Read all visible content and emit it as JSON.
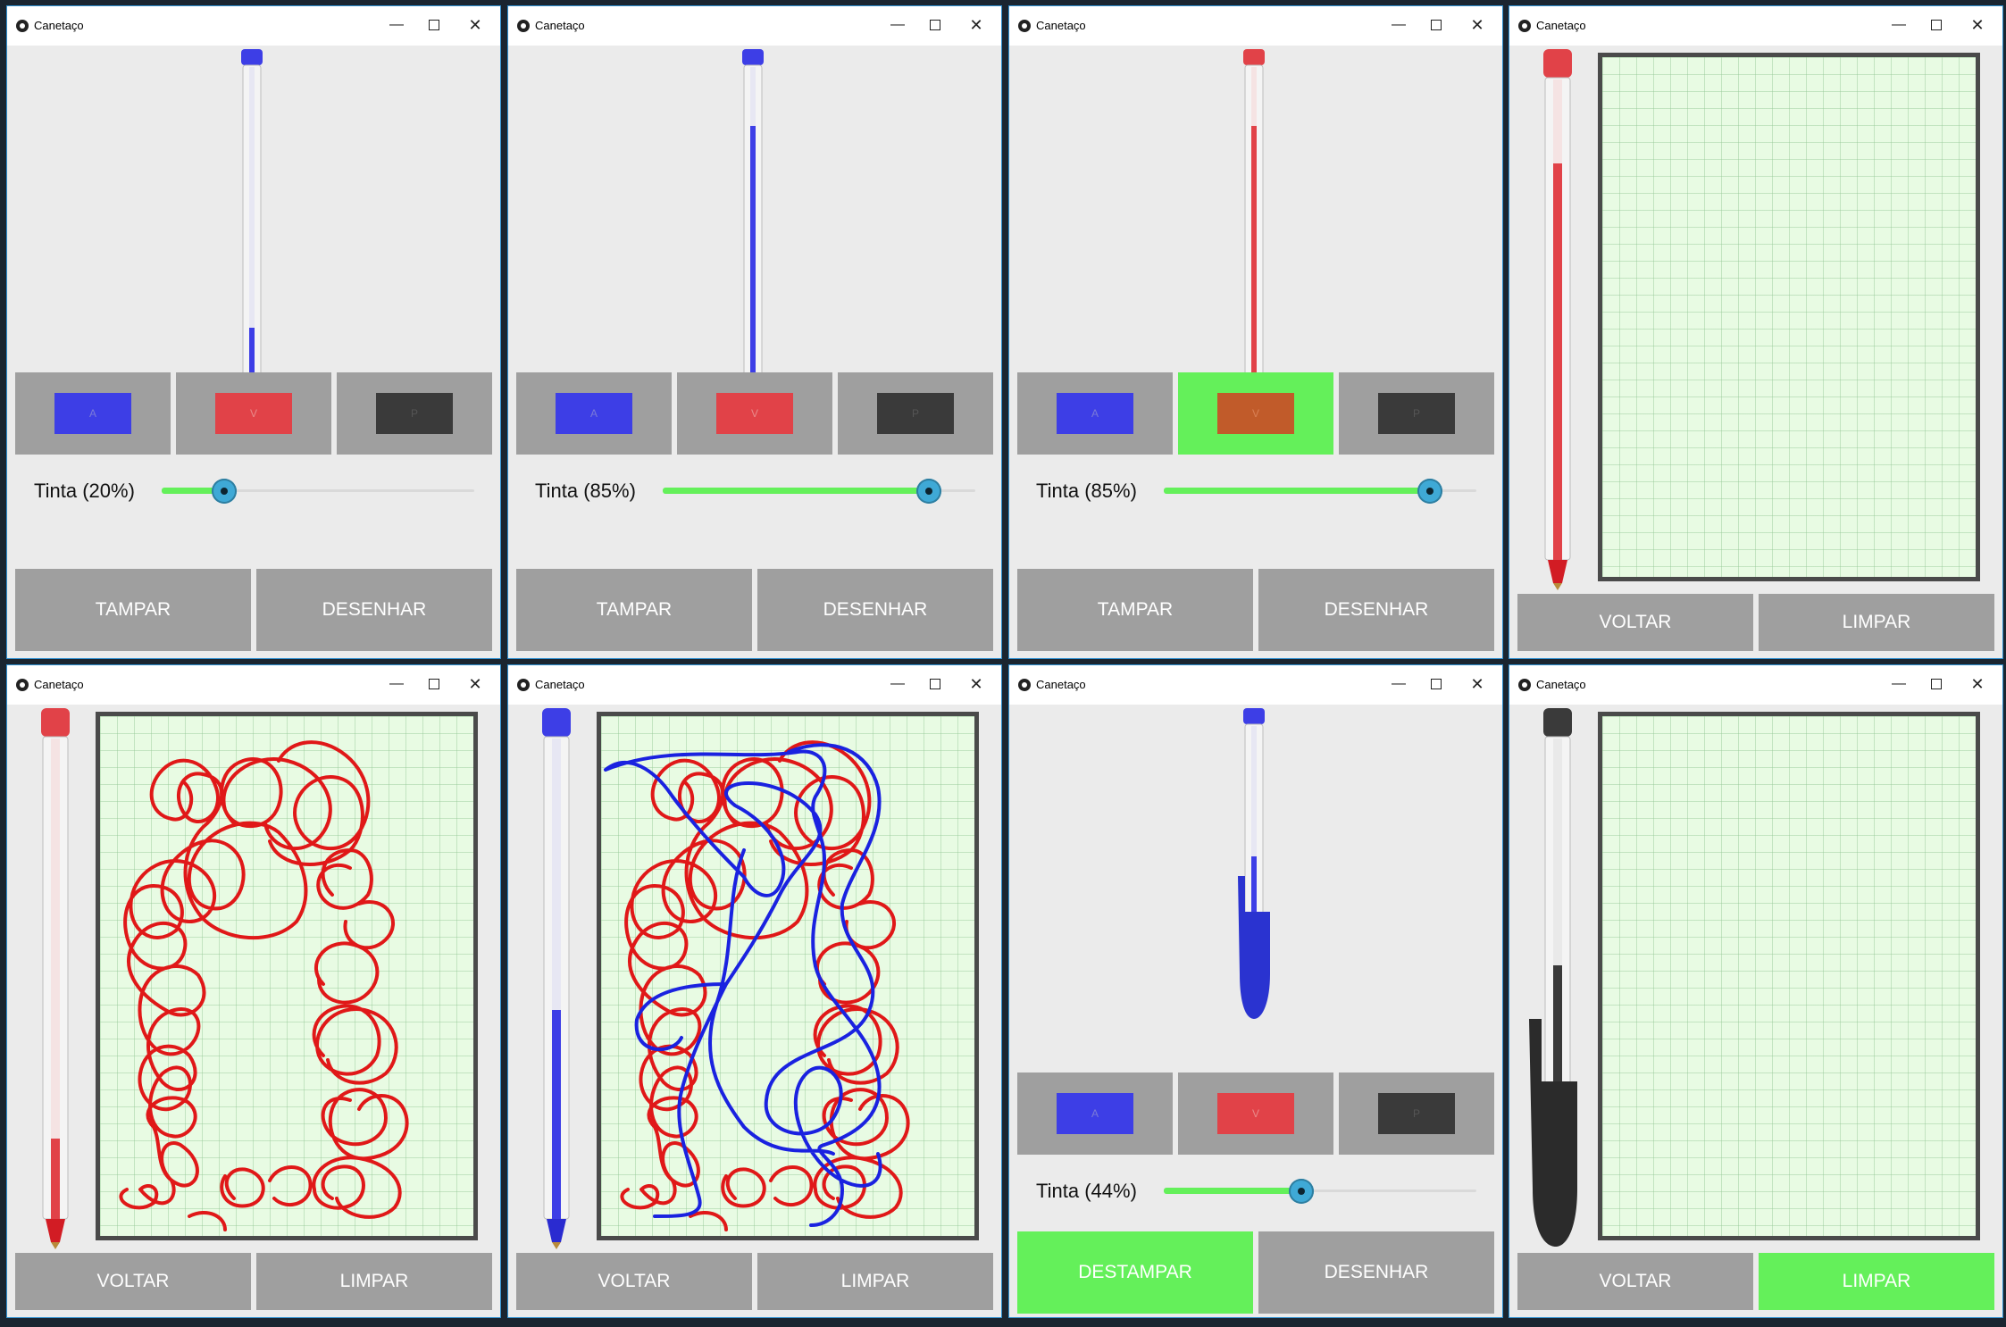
{
  "app": {
    "title": "Canetaço"
  },
  "colors": {
    "blue": "#3d3ee6",
    "red": "#e14248",
    "black": "#3a3a3a",
    "selected_green": "#64f05a",
    "button_gray": "#9f9f9f"
  },
  "panels": [
    {
      "window_title": "Canetaço",
      "mode": "main",
      "pen_color": "blue",
      "capped": false,
      "ink_fraction": 0.2,
      "swatches": [
        "A",
        "V",
        "P"
      ],
      "selected_swatch": null,
      "tinta_label": "Tinta (20%)",
      "action_left": "TAMPAR",
      "action_right": "DESENHAR"
    },
    {
      "window_title": "Canetaço",
      "mode": "main",
      "pen_color": "blue",
      "capped": false,
      "ink_fraction": 0.85,
      "swatches": [
        "A",
        "V",
        "P"
      ],
      "selected_swatch": null,
      "tinta_label": "Tinta (85%)",
      "action_left": "TAMPAR",
      "action_right": "DESENHAR"
    },
    {
      "window_title": "Canetaço",
      "mode": "main",
      "pen_color": "red",
      "capped": false,
      "ink_fraction": 0.85,
      "swatches": [
        "A",
        "V",
        "P"
      ],
      "selected_swatch": "V",
      "tinta_label": "Tinta (85%)",
      "action_left": "TAMPAR",
      "action_right": "DESENHAR"
    },
    {
      "window_title": "Canetaço",
      "mode": "draw",
      "pen_color": "red",
      "capped": false,
      "ink_fraction": 0.85,
      "drawing": "empty",
      "action_left": "VOLTAR",
      "action_right": "LIMPAR",
      "highlight_right": false
    },
    {
      "window_title": "Canetaço",
      "mode": "draw",
      "pen_color": "red",
      "capped": false,
      "ink_fraction": 0.2,
      "drawing": "red",
      "action_left": "VOLTAR",
      "action_right": "LIMPAR",
      "highlight_right": false
    },
    {
      "window_title": "Canetaço",
      "mode": "draw",
      "pen_color": "blue",
      "capped": false,
      "ink_fraction": 0.44,
      "drawing": "red+blue",
      "action_left": "VOLTAR",
      "action_right": "LIMPAR",
      "highlight_right": false
    },
    {
      "window_title": "Canetaço",
      "mode": "main",
      "pen_color": "blue",
      "capped": true,
      "ink_fraction": 0.44,
      "swatches": [
        "A",
        "V",
        "P"
      ],
      "selected_swatch": null,
      "tinta_label": "Tinta (44%)",
      "action_left": "DESTAMPAR",
      "action_right": "DESENHAR",
      "highlight_left": true
    },
    {
      "window_title": "Canetaço",
      "mode": "draw",
      "pen_color": "black",
      "capped": true,
      "ink_fraction": 0.44,
      "drawing": "empty",
      "action_left": "VOLTAR",
      "action_right": "LIMPAR",
      "highlight_right": true
    }
  ]
}
